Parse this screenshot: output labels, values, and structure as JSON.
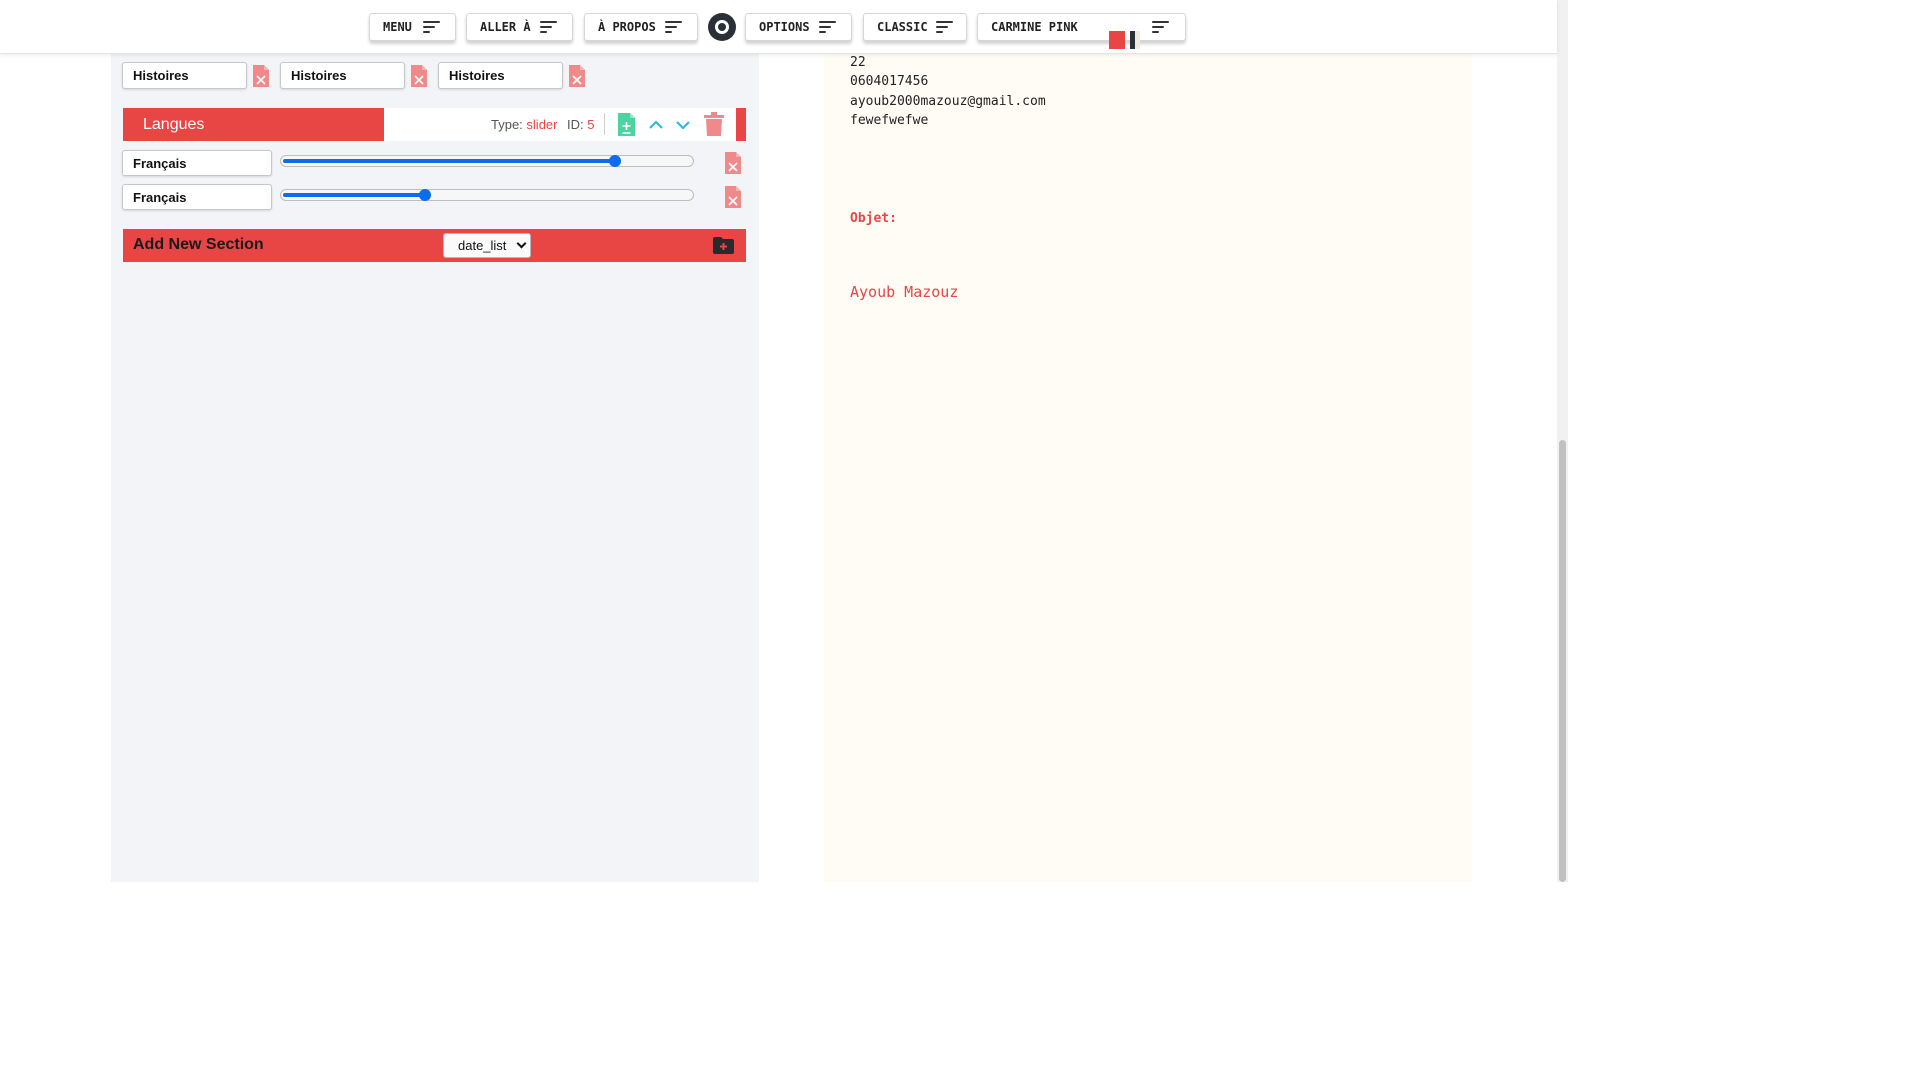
{
  "toolbar": {
    "menu_label": "MENU",
    "goto_label": "ALLER À",
    "about_label": "À PROPOS",
    "options_label": "OPTIONS",
    "template_label": "CLASSIC",
    "theme_label": "CARMINE PINK",
    "theme_swatches": [
      "#e84545",
      "#2b2f37",
      "#f3e9dc"
    ]
  },
  "editor": {
    "prev_section_items": [
      "Histoires",
      "Histoires",
      "Histoires"
    ],
    "section": {
      "title": "Langues",
      "type_label": "Type:",
      "type_value": "slider",
      "id_label": "ID:",
      "id_value": "5",
      "items": [
        {
          "label": "Français",
          "level": 0.81
        },
        {
          "label": "Français",
          "level": 0.35
        }
      ]
    },
    "add_section": {
      "title": "Add New Section",
      "select_value": "date_list"
    }
  },
  "preview": {
    "lines": [
      "22",
      "0604017456",
      "ayoub2000mazouz@gmail.com",
      "fewefwefwe"
    ],
    "object_label": "Objet:",
    "signature": "Ayoub Mazouz"
  },
  "colors": {
    "accent": "#e84545",
    "slider": "#0b6cf0",
    "add_icon": "#4cd3a0",
    "arrow_icon": "#35b6e8"
  }
}
